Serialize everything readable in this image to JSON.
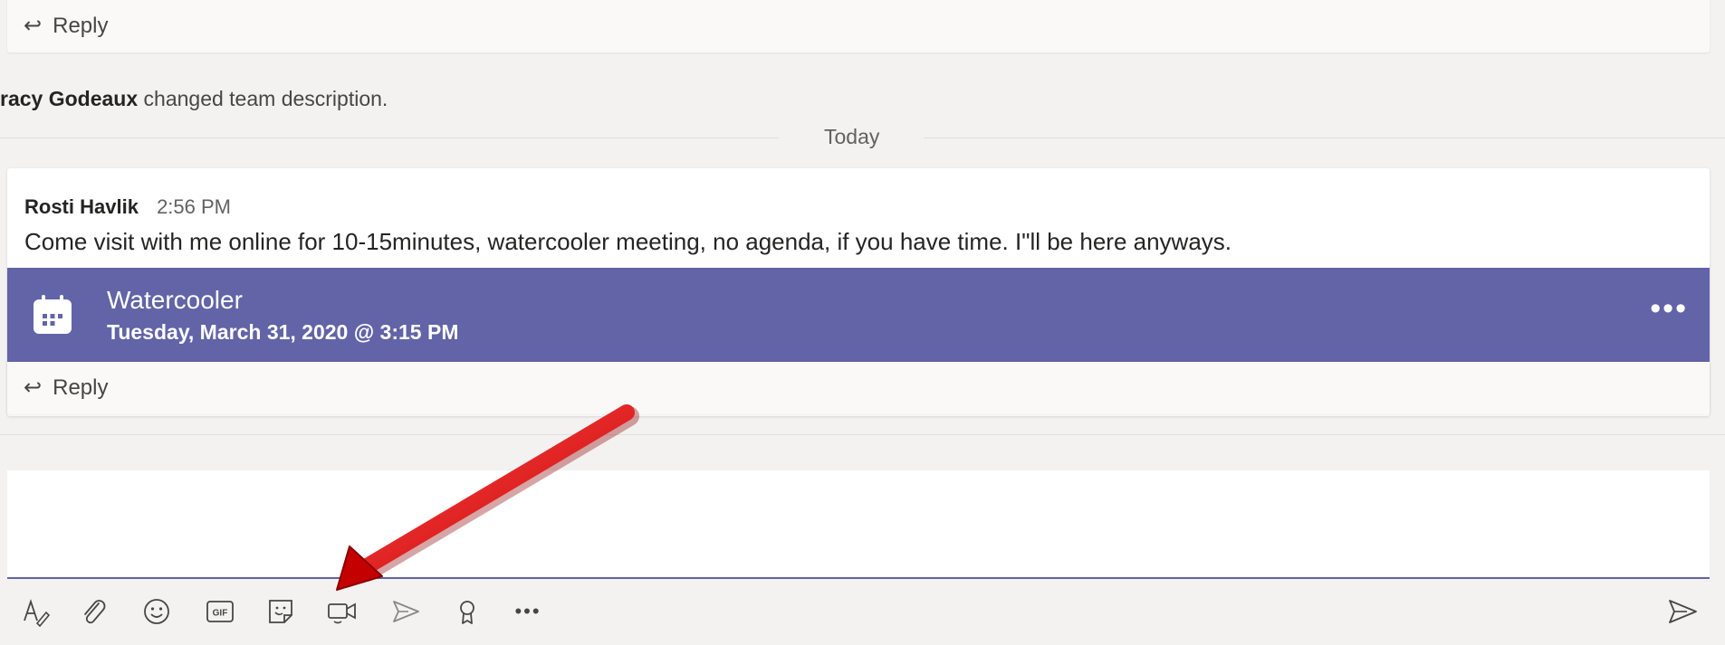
{
  "thread_top": {
    "reply_label": "Reply"
  },
  "system_message": {
    "actor": "racy Godeaux",
    "text": "changed team description."
  },
  "date_divider": {
    "label": "Today"
  },
  "post": {
    "author": "Rosti Havlik",
    "time": "2:56 PM",
    "body": "Come visit with me online for 10-15minutes, watercooler meeting, no agenda, if you have time. I\"ll be here anyways.",
    "meeting": {
      "title": "Watercooler",
      "datetime": "Tuesday, March 31, 2020 @ 3:15 PM",
      "more_label": "•••",
      "accent_color": "#6264a7"
    },
    "reply_label": "Reply"
  },
  "compose": {
    "toolbar": [
      {
        "name": "format-icon"
      },
      {
        "name": "attach-icon"
      },
      {
        "name": "emoji-icon"
      },
      {
        "name": "gif-icon",
        "text": "GIF"
      },
      {
        "name": "sticker-icon"
      },
      {
        "name": "meet-now-icon"
      },
      {
        "name": "stream-icon"
      },
      {
        "name": "praise-icon"
      },
      {
        "name": "more-options-icon",
        "text": "•••"
      }
    ],
    "send_icon": "send-icon"
  },
  "annotation": {
    "color": "#e8161b"
  }
}
